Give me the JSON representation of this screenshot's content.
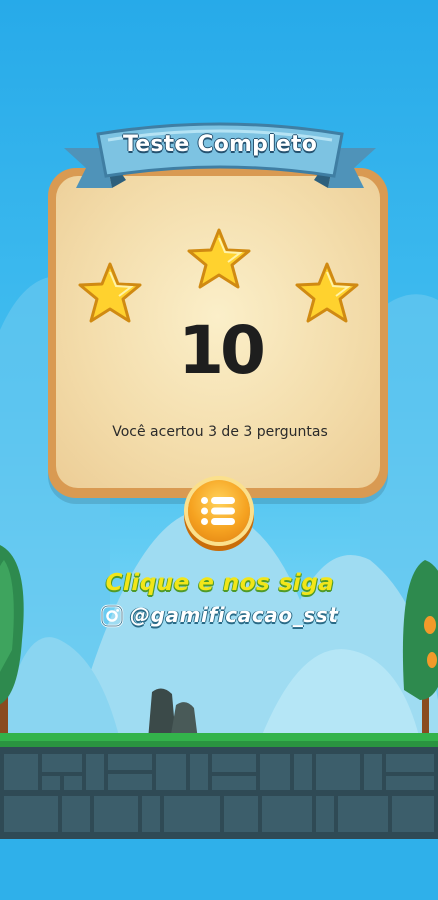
{
  "title": "Teste Completo",
  "score": "10",
  "stars": {
    "earned": 3,
    "total": 3
  },
  "result_text": "Você acertou 3 de 3 perguntas",
  "menu_button_icon": "list-icon",
  "follow": {
    "cta": "Clique e nos siga",
    "handle": "@gamificacao_sst",
    "icon": "instagram-icon"
  },
  "colors": {
    "panel": "#f3dcaa",
    "ribbon": "#6fb6d8",
    "star": "#ffd22e",
    "button": "#f6a321",
    "cta": "#f2e619"
  }
}
